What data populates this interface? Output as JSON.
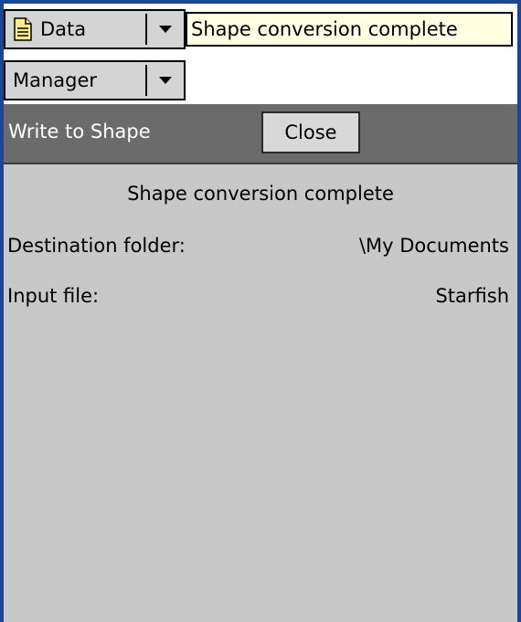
{
  "menu": {
    "data_label": "Data",
    "manager_label": "Manager"
  },
  "tooltip": {
    "text": "Shape conversion complete"
  },
  "window": {
    "title": "Write to Shape",
    "close_label": "Close"
  },
  "content": {
    "status": "Shape conversion complete",
    "destination_label": "Destination folder:",
    "destination_value": "\\My Documents",
    "input_label": "Input file:",
    "input_value": "Starfish"
  },
  "icons": {
    "data": "document-icon",
    "dropdown": "chevron-down-icon"
  },
  "colors": {
    "frame": "#1d4596",
    "titlebar": "#6b6b6b",
    "panel": "#c8c8c8",
    "tooltip": "#ffffe1"
  }
}
